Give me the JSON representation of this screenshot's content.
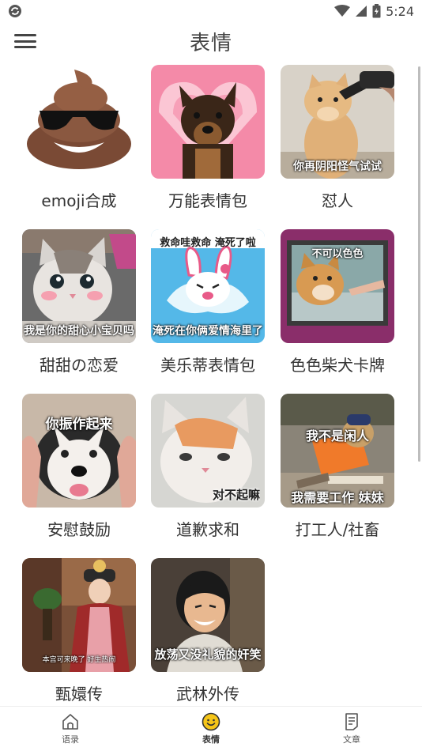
{
  "status_bar": {
    "time": "5:24"
  },
  "header": {
    "title": "表情"
  },
  "grid": {
    "items": [
      {
        "label": "emoji合成",
        "caption": ""
      },
      {
        "label": "万能表情包",
        "caption": ""
      },
      {
        "label": "怼人",
        "caption": "你再阴阳怪气试试"
      },
      {
        "label": "甜甜の恋爱",
        "caption": "我是你的甜心小宝贝吗"
      },
      {
        "label": "美乐蒂表情包",
        "caption_top": "救命哇救命 淹死了啦",
        "caption": "淹死在你俩爱情海里了"
      },
      {
        "label": "色色柴犬卡牌",
        "caption_top": "不可以色色"
      },
      {
        "label": "安慰鼓励",
        "caption_top": "你振作起来"
      },
      {
        "label": "道歉求和",
        "caption": "对不起嘛"
      },
      {
        "label": "打工人/社畜",
        "caption_top": "我不是闲人",
        "caption": "我需要工作 妹妹"
      },
      {
        "label": "甄嬛传",
        "caption": "本宫可来晚了    好生热闹"
      },
      {
        "label": "武林外传",
        "caption": "放荡又没礼貌的奸笑"
      }
    ]
  },
  "bottom_nav": {
    "items": [
      {
        "label": "语录"
      },
      {
        "label": "表情"
      },
      {
        "label": "文章"
      }
    ]
  }
}
